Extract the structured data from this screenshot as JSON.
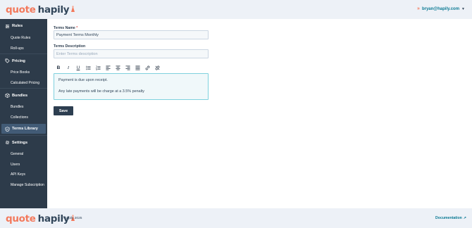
{
  "header": {
    "logo": {
      "word1": "quote",
      "word2": "hapily"
    },
    "user_email": "bryan@hapily.com"
  },
  "sidebar": {
    "sections": [
      {
        "label": "Rules",
        "icon": "sliders-icon",
        "items": [
          "Quote Rules",
          "Roll-ups"
        ]
      },
      {
        "label": "Pricing",
        "icon": "tag-icon",
        "items": [
          "Price Books",
          "Calculated Pricing"
        ]
      },
      {
        "label": "Bundles",
        "icon": "box-icon",
        "items": [
          "Bundles",
          "Collections"
        ]
      },
      {
        "label": "Terms Library",
        "icon": "shield-icon",
        "active": true,
        "items": []
      },
      {
        "label": "Settings",
        "icon": "gear-icon",
        "items": [
          "General",
          "Users",
          "API Keys",
          "Manage Subscription"
        ]
      }
    ]
  },
  "form": {
    "name_label": "Terms Name",
    "required_mark": "*",
    "name_value": "Payment Terms Monthly",
    "description_label": "Terms Description",
    "description_placeholder": "Enter Terms description",
    "editor_lines": [
      "Payment is due upon receipt.",
      "Any late payments will be charge at a 3.5% penalty"
    ],
    "save_label": "Save",
    "toolbar": [
      "B",
      "I",
      "U"
    ]
  },
  "footer": {
    "logo": {
      "word1": "quote",
      "word2": "hapily"
    },
    "copyright": "© hapily 2025",
    "doc_link": "Documentation"
  },
  "colors": {
    "accent": "#f3795c",
    "link": "#0b7a94",
    "sidebar_bg": "#2d3b4a",
    "active_item": "#425b76",
    "editor_border": "#7fd1de"
  }
}
